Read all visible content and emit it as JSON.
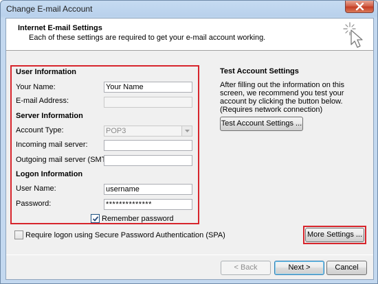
{
  "window": {
    "title": "Change E-mail Account"
  },
  "header": {
    "title": "Internet E-mail Settings",
    "subtitle": "Each of these settings are required to get your e-mail account working."
  },
  "user_info": {
    "title": "User Information",
    "your_name_label": "Your Name:",
    "your_name_value": "Your Name",
    "email_label": "E-mail Address:",
    "email_value": ""
  },
  "server_info": {
    "title": "Server Information",
    "account_type_label": "Account Type:",
    "account_type_value": "POP3",
    "incoming_label": "Incoming mail server:",
    "incoming_value": "",
    "outgoing_label": "Outgoing mail server (SMTP):",
    "outgoing_value": ""
  },
  "logon_info": {
    "title": "Logon Information",
    "username_label": "User Name:",
    "username_value": "username",
    "password_label": "Password:",
    "password_value": "**************",
    "remember_label": "Remember password",
    "remember_checked": true,
    "spa_label": "Require logon using Secure Password Authentication (SPA)",
    "spa_checked": false
  },
  "test_settings": {
    "title": "Test Account Settings",
    "description": "After filling out the information on this screen, we recommend you test your account by clicking the button below. (Requires network connection)",
    "button_label": "Test Account Settings ..."
  },
  "buttons": {
    "more_settings": "More Settings ...",
    "back": "< Back",
    "next": "Next >",
    "cancel": "Cancel"
  },
  "colors": {
    "highlight": "#d7242b",
    "title_bar": "#c3d8ef",
    "default_button_border": "#3c7fb1"
  },
  "icons": {
    "close": "close-icon",
    "wizard": "wizard-sparkle-cursor-icon",
    "dropdown": "chevron-down-icon",
    "check": "check-icon"
  }
}
